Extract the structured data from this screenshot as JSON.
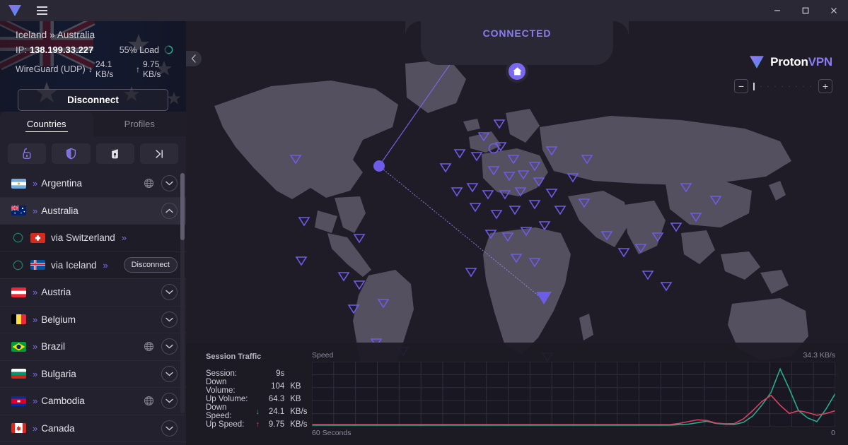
{
  "titlebar": {
    "logo_icon": "proton-triangle-logo",
    "menu_icon": "hamburger-menu-icon",
    "minimize_icon": "minimize-icon",
    "maximize_icon": "maximize-icon",
    "close_icon": "close-icon"
  },
  "connection": {
    "route": "Iceland » Australia",
    "ip_label": "IP:",
    "ip_value": "138.199.33.227",
    "load": "55% Load",
    "protocol": "WireGuard (UDP)",
    "down_speed": "24.1 KB/s",
    "up_speed": "9.75 KB/s",
    "down_arrow": "↓",
    "up_arrow": "↑",
    "disconnect_label": "Disconnect",
    "load_color": "#1ea885"
  },
  "tabs": [
    {
      "label": "Countries",
      "active": true
    },
    {
      "label": "Profiles",
      "active": false
    }
  ],
  "filters": [
    {
      "name": "secure-core-filter",
      "icon": "secure-core-lock-icon"
    },
    {
      "name": "p2p-filter",
      "icon": "shield-icon"
    },
    {
      "name": "tor-filter",
      "icon": "tor-onion-icon"
    },
    {
      "name": "fastest-filter",
      "icon": "fastest-arrow-icon"
    }
  ],
  "countries": [
    {
      "name": "Argentina",
      "flag": "ar",
      "globe": true,
      "expanded": false,
      "selected": false
    },
    {
      "name": "Australia",
      "flag": "au",
      "globe": false,
      "expanded": true,
      "selected": true
    },
    {
      "name": "Austria",
      "flag": "at",
      "globe": false,
      "expanded": false,
      "selected": false
    },
    {
      "name": "Belgium",
      "flag": "be",
      "globe": false,
      "expanded": false,
      "selected": false
    },
    {
      "name": "Brazil",
      "flag": "br",
      "globe": true,
      "expanded": false,
      "selected": false
    },
    {
      "name": "Bulgaria",
      "flag": "bg",
      "globe": false,
      "expanded": false,
      "selected": false
    },
    {
      "name": "Cambodia",
      "flag": "kh",
      "globe": true,
      "expanded": false,
      "selected": false
    },
    {
      "name": "Canada",
      "flag": "ca",
      "globe": false,
      "expanded": false,
      "selected": false
    }
  ],
  "secure_core_servers": [
    {
      "name": "via Switzerland",
      "flag": "ch",
      "connected": false,
      "action": null
    },
    {
      "name": "via Iceland",
      "flag": "is",
      "connected": true,
      "action": "Disconnect"
    }
  ],
  "map": {
    "status": "CONNECTED",
    "home_icon": "home-icon",
    "collapse_icon": "chevron-left-icon",
    "brand_primary": "Proton",
    "brand_accent": "VPN",
    "zoom_minus": "−",
    "zoom_plus": "+",
    "marker_color": "#6c5ce7",
    "land_color": "#55505f"
  },
  "session_traffic": {
    "title": "Session Traffic",
    "rows": [
      {
        "label": "Session:",
        "arrow": "",
        "value": "9s",
        "unit": ""
      },
      {
        "label": "Down Volume:",
        "arrow": "",
        "value": "104",
        "unit": "KB"
      },
      {
        "label": "Up Volume:",
        "arrow": "",
        "value": "64.3",
        "unit": "KB"
      },
      {
        "label": "Down Speed:",
        "arrow": "↓",
        "value": "24.1",
        "unit": "KB/s",
        "arrow_color": "#27ae78"
      },
      {
        "label": "Up Speed:",
        "arrow": "↑",
        "value": "9.75",
        "unit": "KB/s",
        "arrow_color": "#d9415f"
      }
    ]
  },
  "chart_data": {
    "type": "line",
    "title": "Speed",
    "xlabel": "60 Seconds",
    "ylabel_max": "34.3  KB/s",
    "ylabel_min": "0",
    "grid": true,
    "x_range_seconds": 60,
    "ylim": [
      0,
      34.3
    ],
    "grid_rows": 5,
    "grid_cols": 24,
    "series": [
      {
        "name": "Download",
        "color": "#2aa98a",
        "values": [
          0,
          0,
          0,
          0,
          0,
          0,
          0,
          0,
          0,
          0,
          0,
          0,
          0,
          0,
          0,
          0,
          0,
          0,
          0,
          0,
          0,
          0,
          0,
          0,
          0,
          0,
          0,
          0,
          0,
          0,
          0,
          0,
          0,
          0,
          0,
          0,
          0,
          0,
          0,
          0,
          0.3,
          0.6,
          1.4,
          2.2,
          1.0,
          0.5,
          0.4,
          1.6,
          5.0,
          11.0,
          18.0,
          31.0,
          20.0,
          8.0,
          4.0,
          2.0,
          9.0,
          17.5
        ]
      },
      {
        "name": "Upload",
        "color": "#d9415f",
        "values": [
          0.4,
          0.4,
          0.4,
          0.4,
          0.4,
          0.4,
          0.4,
          0.4,
          0.4,
          0.4,
          0.4,
          0.4,
          0.4,
          0.4,
          0.4,
          0.4,
          0.4,
          0.4,
          0.4,
          0.4,
          0.4,
          0.4,
          0.4,
          0.4,
          0.4,
          0.4,
          0.4,
          0.4,
          0.4,
          0.4,
          0.4,
          0.4,
          0.4,
          0.4,
          0.4,
          0.4,
          0.4,
          0.4,
          0.4,
          0.4,
          1.0,
          2.0,
          3.0,
          2.6,
          1.2,
          0.8,
          0.9,
          3.5,
          8.0,
          13.0,
          16.5,
          11.0,
          6.5,
          8.0,
          7.0,
          5.5,
          6.5,
          8.0
        ]
      }
    ]
  }
}
